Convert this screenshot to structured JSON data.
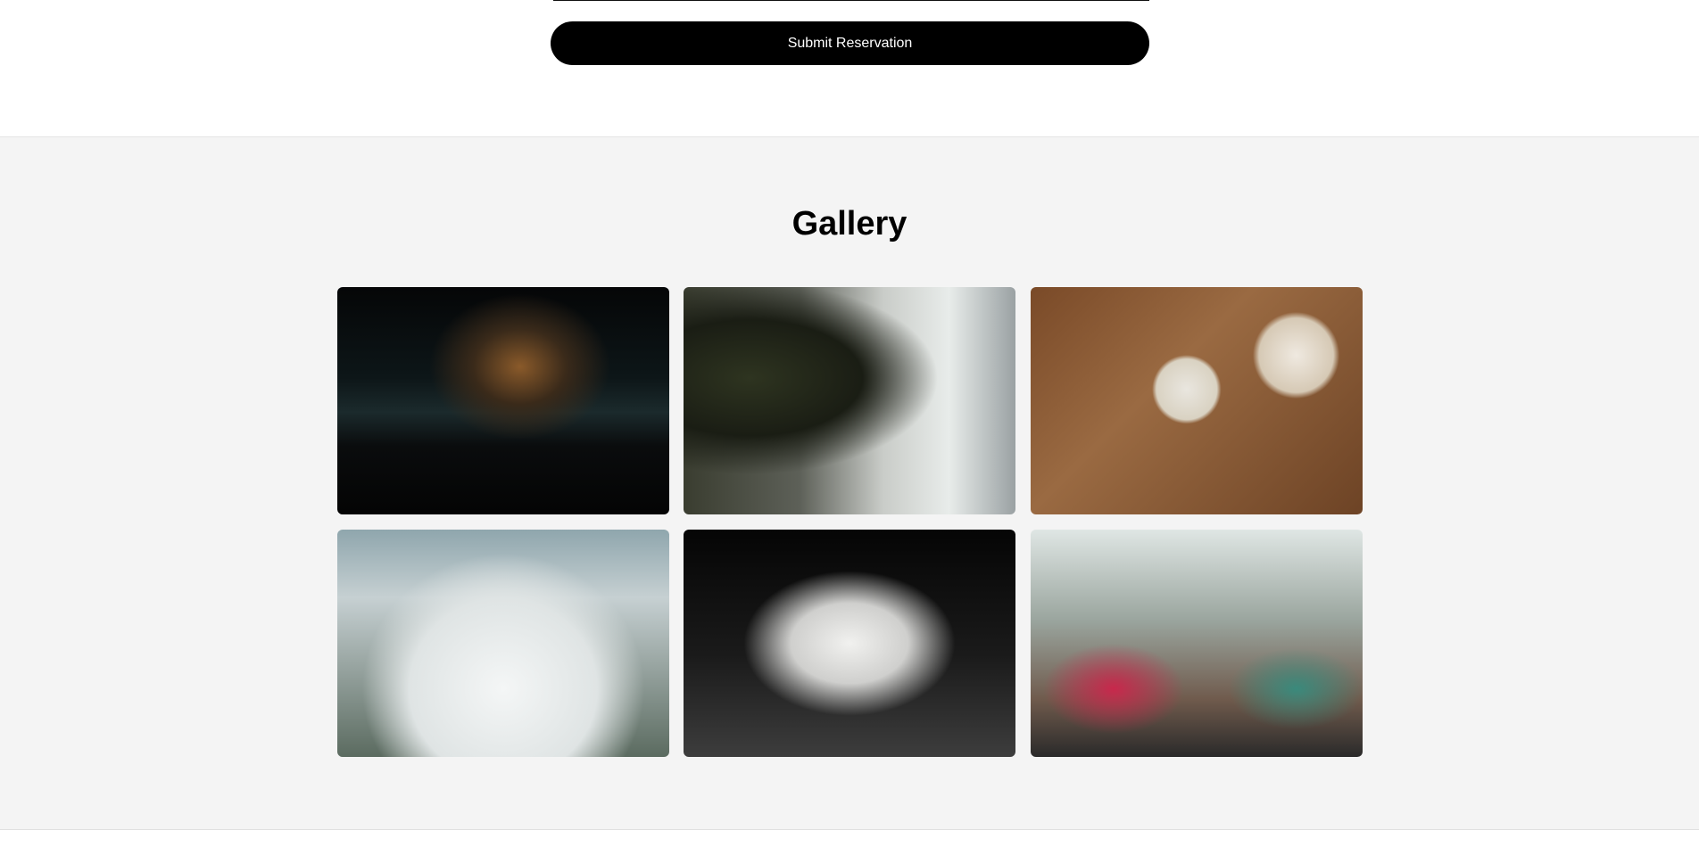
{
  "form": {
    "submit_label": "Submit Reservation"
  },
  "gallery": {
    "title": "Gallery",
    "images": [
      {
        "alt": "restaurant-kitchen"
      },
      {
        "alt": "dining-room"
      },
      {
        "alt": "shared-dishes-table"
      },
      {
        "alt": "plated-dessert"
      },
      {
        "alt": "sauce-pour-dish"
      },
      {
        "alt": "friends-toasting"
      }
    ]
  }
}
